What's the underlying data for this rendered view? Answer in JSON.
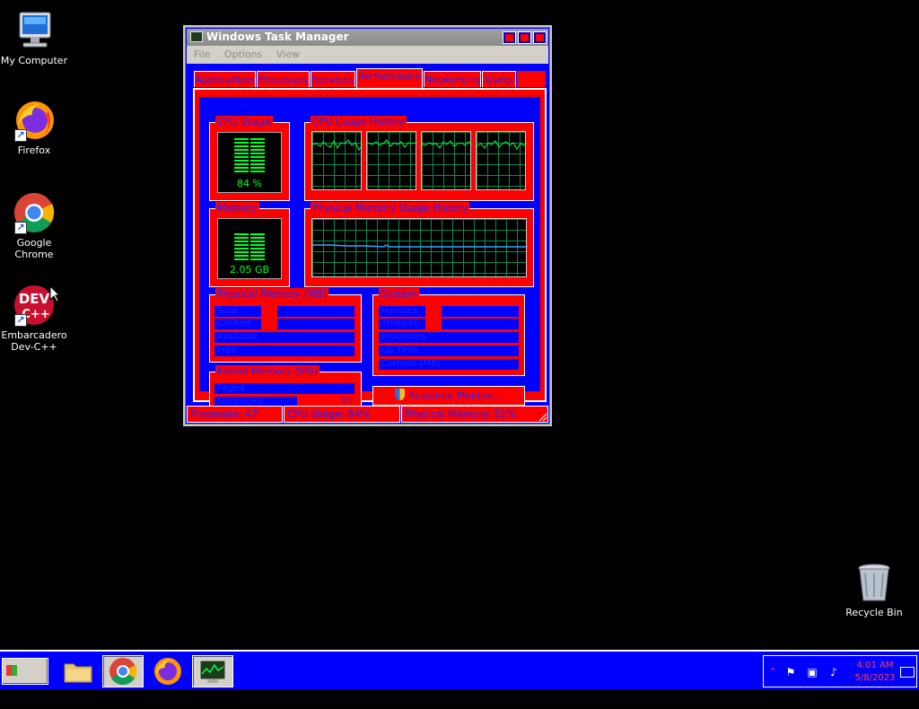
{
  "desktop": {
    "icons": [
      {
        "label": "My Computer"
      },
      {
        "label": "Firefox"
      },
      {
        "label": "Google Chrome"
      },
      {
        "label": "Embarcadero Dev-C++"
      },
      {
        "label": "Recycle Bin"
      }
    ]
  },
  "window": {
    "title": "Windows Task Manager",
    "menu": [
      "File",
      "Options",
      "View"
    ],
    "tabs": [
      "Applications",
      "Processes",
      "Services",
      "Performance",
      "Networking",
      "Users"
    ],
    "active_tab": "Performance",
    "cpu_usage": {
      "label": "CPU Usage",
      "value": "84 %",
      "level": 0.84
    },
    "cpu_history": {
      "label": "CPU Usage History",
      "cores": 4
    },
    "memory": {
      "label": "Memory",
      "value": "2.05 GB"
    },
    "mem_history": {
      "label": "Physical Memory Usage History"
    },
    "physical_memory": {
      "label": "Physical Memory (MB)",
      "rows": [
        "Total",
        "Cached",
        "Available",
        "Free"
      ]
    },
    "kernel_memory": {
      "label": "Kernel Memory (MB)",
      "rows": [
        {
          "k": "Paged",
          "v": ""
        },
        {
          "k": "Nonpaged",
          "v": "31"
        }
      ]
    },
    "system": {
      "label": "System",
      "rows": [
        "Handles",
        "Threads",
        "Processes",
        "Up Time",
        "Commit (MB)"
      ]
    },
    "resource_monitor": "Resource Monitor...",
    "status": {
      "processes": "Processes: 47",
      "cpu": "CPU Usage: 84%",
      "memory": "Physical Memory: 51%"
    }
  },
  "taskbar": {
    "start": "Start",
    "pinned": [
      "file-explorer-icon",
      "chrome-icon",
      "firefox-icon",
      "task-manager-icon"
    ],
    "time": "4:01 AM",
    "date": "5/8/2023"
  }
}
